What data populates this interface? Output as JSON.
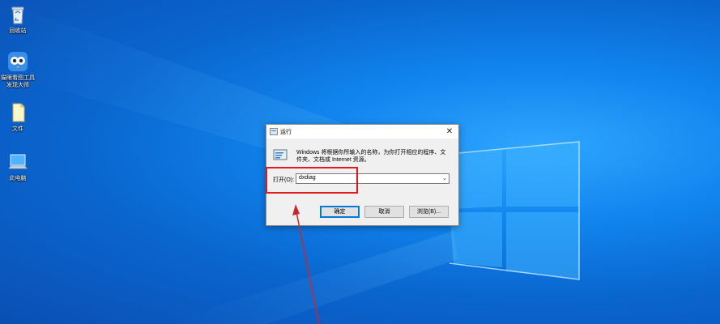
{
  "desktop": {
    "icons": [
      {
        "name": "recycle-bin",
        "label": "回收站"
      },
      {
        "name": "app-shortcut",
        "label": "猫眼看图工具\n发现大师"
      },
      {
        "name": "file",
        "label": "文件"
      },
      {
        "name": "this-pc",
        "label": "此电脑"
      }
    ]
  },
  "run_dialog": {
    "title": "运行",
    "close_glyph": "✕",
    "description": "Windows 将根据你所输入的名称，为你打开相应的程序、文件夹、文档或 Internet 资源。",
    "open_label": "打开(O):",
    "open_value": "dxdiag",
    "dropdown_glyph": "⌄",
    "buttons": {
      "ok": "确定",
      "cancel": "取消",
      "browse": "浏览(B)..."
    }
  },
  "colors": {
    "highlight": "#e0191e",
    "wallpaper": "#0a6fd6",
    "accent": "#0078d7"
  }
}
